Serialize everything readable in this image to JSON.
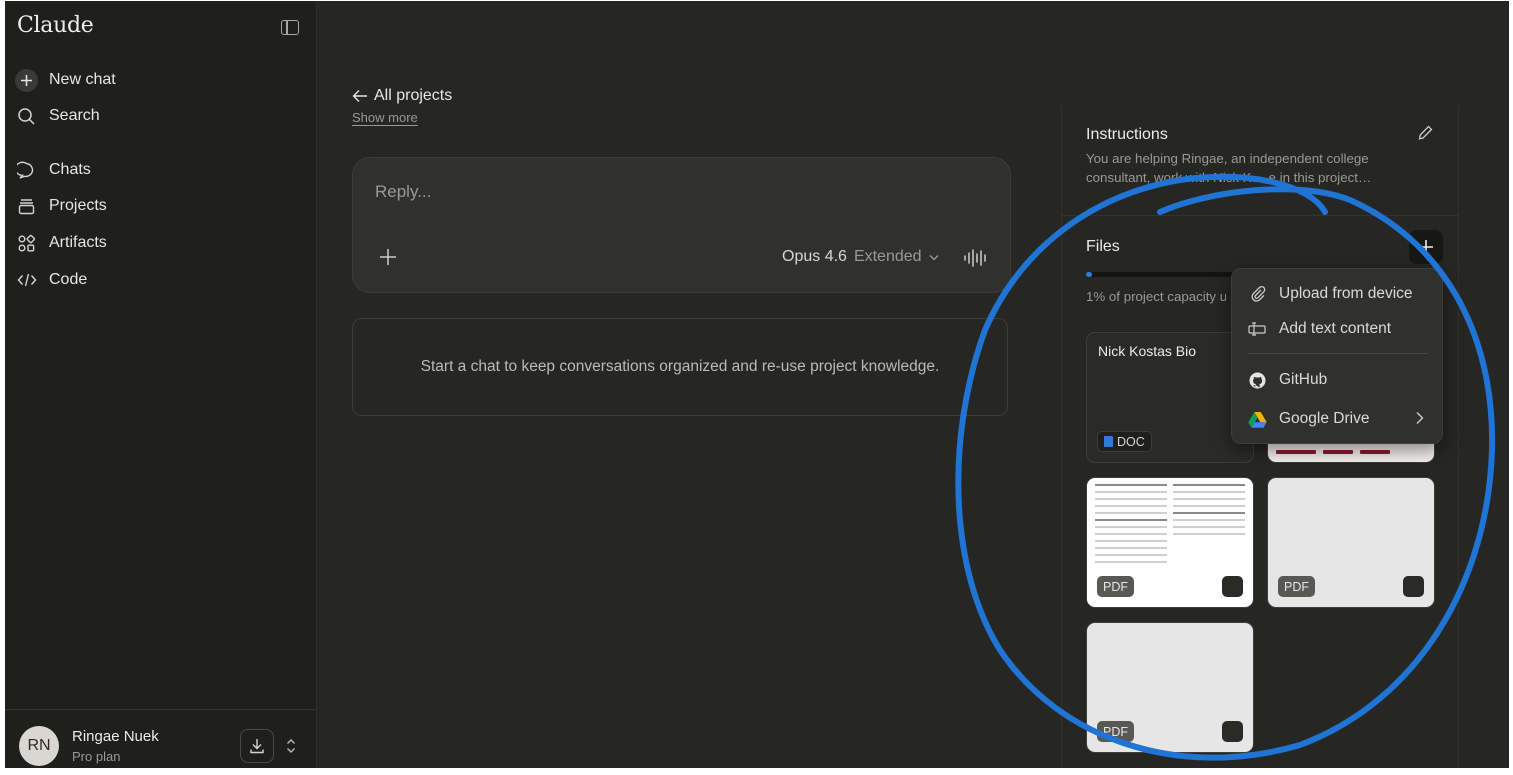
{
  "app": {
    "brand": "Claude"
  },
  "sidebar": {
    "toggle_icon": "sidebar-panel-icon",
    "items": [
      {
        "label": "New chat",
        "icon": "plus-icon"
      },
      {
        "label": "Search",
        "icon": "search-icon"
      },
      {
        "label": "Chats",
        "icon": "chat-bubble-icon"
      },
      {
        "label": "Projects",
        "icon": "folder-stack-icon"
      },
      {
        "label": "Artifacts",
        "icon": "shapes-icon"
      },
      {
        "label": "Code",
        "icon": "code-brackets-icon"
      }
    ],
    "user": {
      "initials": "RN",
      "name": "Ringae Nuek",
      "plan": "Pro plan"
    }
  },
  "main": {
    "back_label": "All projects",
    "show_more": "Show more",
    "composer": {
      "placeholder": "Reply...",
      "model": "Opus 4.6",
      "mode": "Extended"
    },
    "empty_state": "Start a chat to keep conversations organized and re-use project knowledge."
  },
  "panel": {
    "instructions_title": "Instructions",
    "instructions_text": "You are helping Ringae, an independent college consultant, work with Nick K… e in this project…",
    "files_title": "Files",
    "capacity": {
      "text": "1% of project capacity u",
      "fraction": 0.01
    },
    "files": [
      {
        "title": "Nick Kostas Bio",
        "type": "DOC"
      },
      {
        "type": "PDF"
      },
      {
        "type": "PDF"
      },
      {
        "type": "PDF"
      }
    ]
  },
  "menu": {
    "items": [
      {
        "label": "Upload from device",
        "icon": "paperclip-icon"
      },
      {
        "label": "Add text content",
        "icon": "text-cursor-icon"
      },
      {
        "label": "GitHub",
        "icon": "github-icon"
      },
      {
        "label": "Google Drive",
        "icon": "google-drive-icon"
      }
    ]
  },
  "colors": {
    "background": "#262624",
    "sidebar": "#1f1f1e",
    "accent_blue": "#2f7bd9",
    "annotation_stroke": "#1f74d4"
  }
}
